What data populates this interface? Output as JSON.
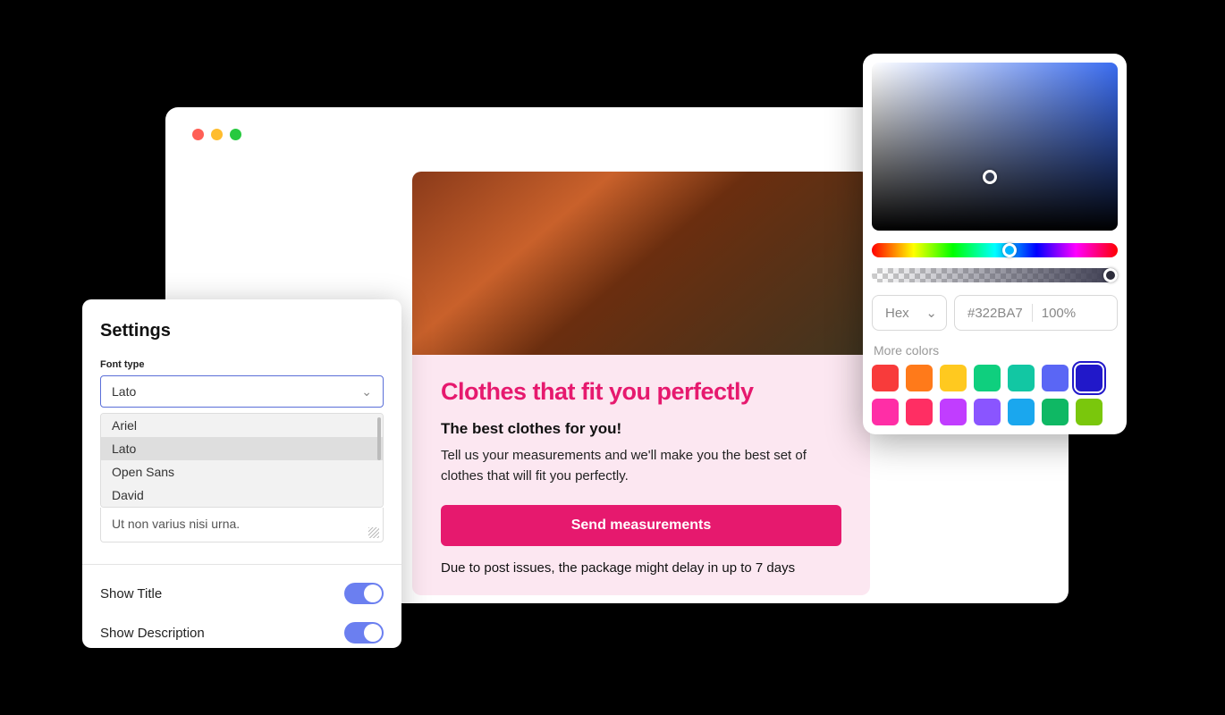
{
  "browser": {
    "traffic_lights": [
      "red",
      "yellow",
      "green"
    ]
  },
  "content": {
    "title": "Clothes that fit you perfectly",
    "subtitle": "The best clothes for you!",
    "description": "Tell us your measurements and we'll make you the best set of clothes that will fit you perfectly.",
    "cta_label": "Send measurements",
    "note": "Due to post issues, the package might delay in up to 7 days"
  },
  "settings": {
    "title": "Settings",
    "font_type_label": "Font type",
    "font_type_value": "Lato",
    "font_options": [
      "Ariel",
      "Lato",
      "Open Sans",
      "David"
    ],
    "textarea_value": "Ut non varius nisi urna.",
    "show_title_label": "Show Title",
    "show_title_value": true,
    "show_description_label": "Show Description",
    "show_description_value": true
  },
  "color_picker": {
    "format_label": "Hex",
    "hex_value": "#322BA7",
    "opacity_value": "100%",
    "more_colors_label": "More colors",
    "swatches": [
      {
        "color": "#f83b3b",
        "selected": false
      },
      {
        "color": "#ff7a1a",
        "selected": false
      },
      {
        "color": "#ffc91f",
        "selected": false
      },
      {
        "color": "#0fcf7e",
        "selected": false
      },
      {
        "color": "#12c7a3",
        "selected": false
      },
      {
        "color": "#5a66f5",
        "selected": false
      },
      {
        "color": "#2118c9",
        "selected": true
      },
      {
        "color": "#ff2ea6",
        "selected": false
      },
      {
        "color": "#ff2e63",
        "selected": false
      },
      {
        "color": "#c13dff",
        "selected": false
      },
      {
        "color": "#8a55ff",
        "selected": false
      },
      {
        "color": "#1aa7ee",
        "selected": false
      },
      {
        "color": "#0fb864",
        "selected": false
      },
      {
        "color": "#7ac70c",
        "selected": false
      }
    ]
  }
}
